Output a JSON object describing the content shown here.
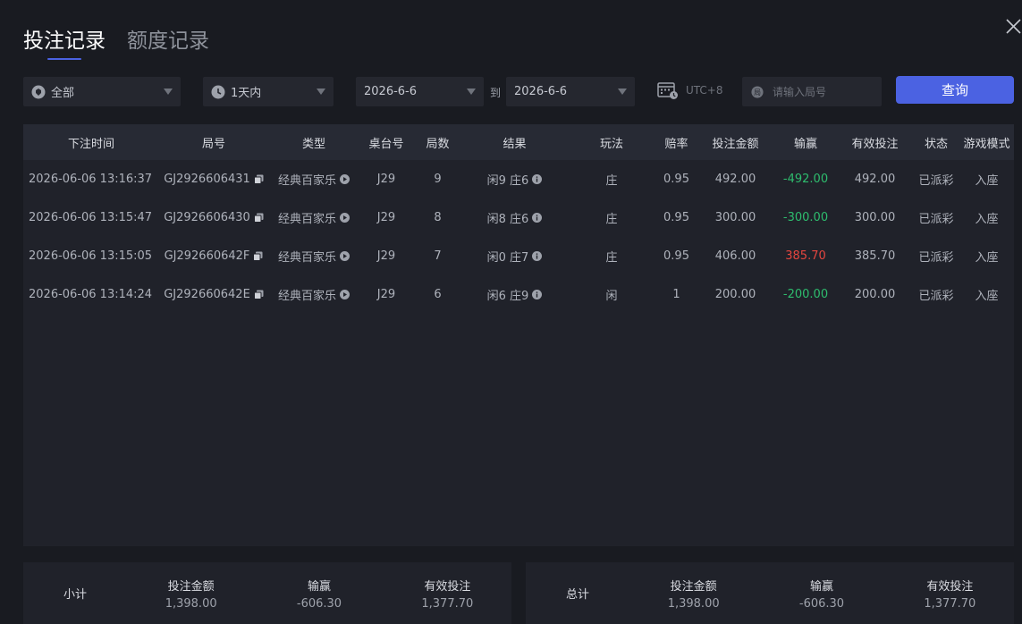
{
  "tabs": [
    {
      "label": "投注记录"
    },
    {
      "label": "额度记录"
    }
  ],
  "filters": {
    "category": "全部",
    "range": "1天内",
    "date_from": "2026-6-6",
    "to_label": "到",
    "date_to": "2026-6-6",
    "timezone": "UTC+8",
    "search_placeholder": "请输入局号",
    "query_label": "查询"
  },
  "table": {
    "headers": [
      "下注时间",
      "局号",
      "类型",
      "桌台号",
      "局数",
      "结果",
      "玩法",
      "赔率",
      "投注金额",
      "输赢",
      "有效投注",
      "状态",
      "游戏模式"
    ],
    "rows": [
      {
        "time": "2026-06-06 13:16:37",
        "round_id": "GJ2926606431",
        "type": "经典百家乐",
        "table": "J29",
        "round": "9",
        "result": "闲9 庄6",
        "bet": "庄",
        "odds": "0.95",
        "amount": "492.00",
        "winloss": "-492.00",
        "valid": "492.00",
        "status": "已派彩",
        "mode": "入座"
      },
      {
        "time": "2026-06-06 13:15:47",
        "round_id": "GJ2926606430",
        "type": "经典百家乐",
        "table": "J29",
        "round": "8",
        "result": "闲8 庄6",
        "bet": "庄",
        "odds": "0.95",
        "amount": "300.00",
        "winloss": "-300.00",
        "valid": "300.00",
        "status": "已派彩",
        "mode": "入座"
      },
      {
        "time": "2026-06-06 13:15:05",
        "round_id": "GJ292660642F",
        "type": "经典百家乐",
        "table": "J29",
        "round": "7",
        "result": "闲0 庄7",
        "bet": "庄",
        "odds": "0.95",
        "amount": "406.00",
        "winloss": "385.70",
        "valid": "385.70",
        "status": "已派彩",
        "mode": "入座"
      },
      {
        "time": "2026-06-06 13:14:24",
        "round_id": "GJ292660642E",
        "type": "经典百家乐",
        "table": "J29",
        "round": "6",
        "result": "闲6 庄9",
        "bet": "闲",
        "odds": "1",
        "amount": "200.00",
        "winloss": "-200.00",
        "valid": "200.00",
        "status": "已派彩",
        "mode": "入座"
      }
    ]
  },
  "subtotal": {
    "label": "小计",
    "bet_label": "投注金额",
    "bet": "1,398.00",
    "winloss_label": "输赢",
    "winloss": "-606.30",
    "valid_label": "有效投注",
    "valid": "1,377.70"
  },
  "total": {
    "label": "总计",
    "bet_label": "投注金额",
    "bet": "1,398.00",
    "winloss_label": "输赢",
    "winloss": "-606.30",
    "valid_label": "有效投注",
    "valid": "1,377.70"
  },
  "colors": {
    "accent": "#4b62e2",
    "loss": "#2ebd6e",
    "win": "#e5463f",
    "background": "#191b21"
  },
  "icons": [
    "close-icon",
    "game-category-icon",
    "clock-icon",
    "calendar-icon",
    "round-search-icon",
    "copy-icon",
    "play-icon",
    "info-icon",
    "dropdown-arrow-icon"
  ]
}
